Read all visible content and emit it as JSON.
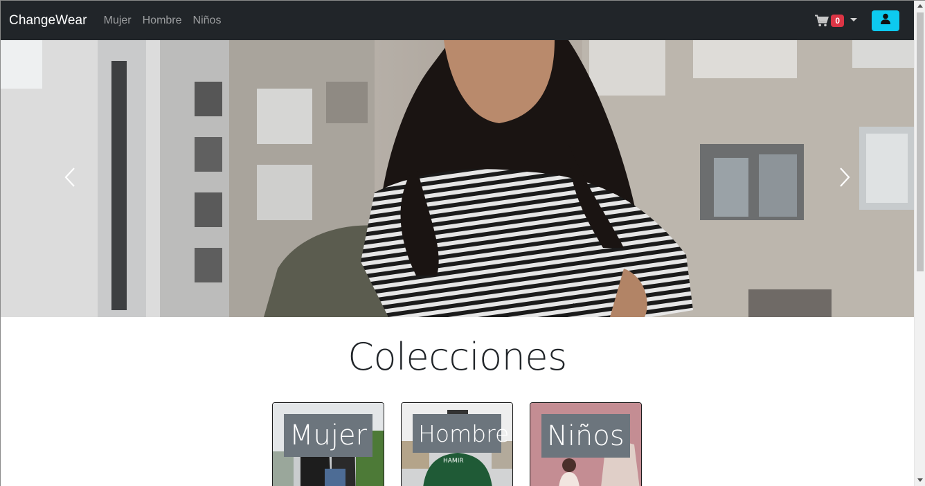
{
  "navbar": {
    "brand": "ChangeWear",
    "links": [
      "Mujer",
      "Hombre",
      "Niños"
    ],
    "cart_count": "0"
  },
  "colors": {
    "navbar_bg": "#212529",
    "badge_bg": "#dc3545",
    "user_button_bg": "#0dcaf0",
    "card_label_bg": "#6c757d"
  },
  "icons": {
    "cart": "cart-icon",
    "dropdown": "caret-down-icon",
    "user": "user-icon",
    "prev": "chevron-left-icon",
    "next": "chevron-right-icon"
  },
  "collections": {
    "title": "Colecciones",
    "cards": [
      {
        "label": "Mujer"
      },
      {
        "label": "Hombre"
      },
      {
        "label": "Niños"
      }
    ]
  }
}
